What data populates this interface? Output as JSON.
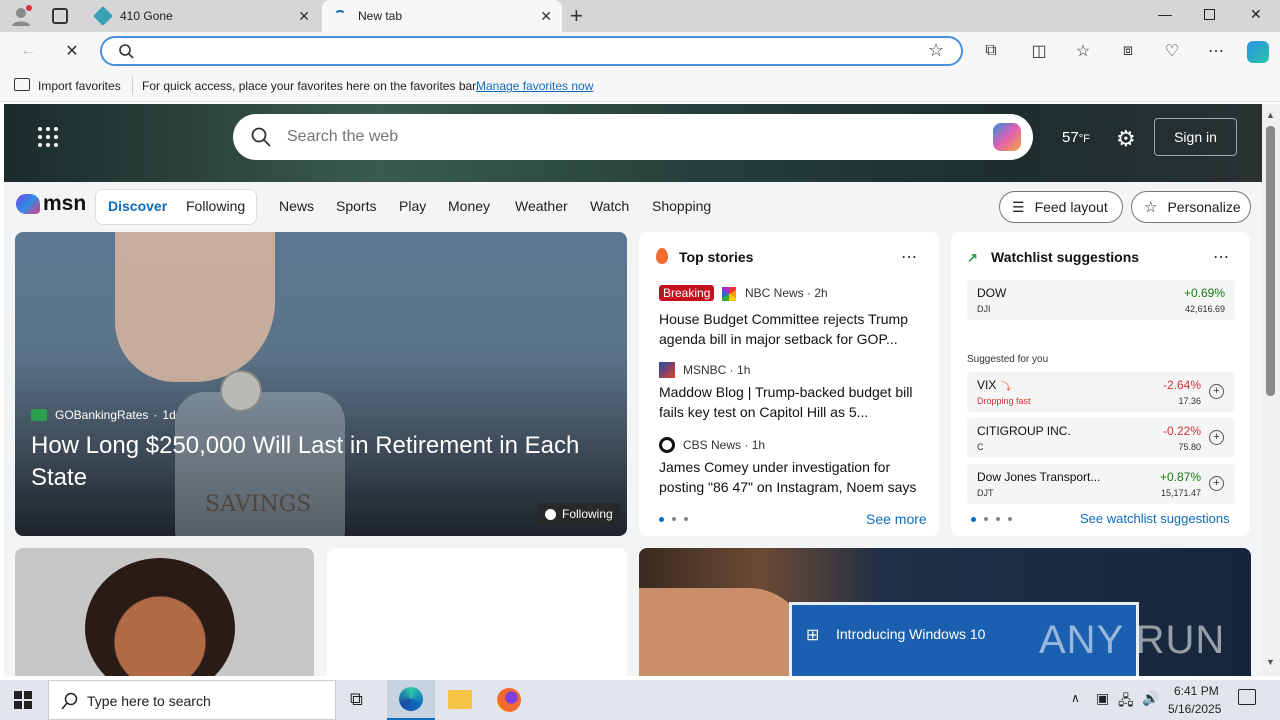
{
  "tabs": [
    {
      "title": "410 Gone"
    },
    {
      "title": "New tab"
    }
  ],
  "address": {
    "placeholder": ""
  },
  "favbar": {
    "import": "Import favorites",
    "message": "For quick access, place your favorites here on the favorites bar.",
    "link": "Manage favorites now"
  },
  "msn": {
    "search_placeholder": "Search the web",
    "temperature": "57",
    "temp_unit": "°F",
    "sign_in": "Sign in",
    "logo": "msn"
  },
  "nav": {
    "discover": "Discover",
    "following": "Following",
    "links": [
      "News",
      "Sports",
      "Play",
      "Money",
      "Weather",
      "Watch",
      "Shopping"
    ],
    "feed_layout": "Feed layout",
    "personalize": "Personalize"
  },
  "hero": {
    "source": "GOBankingRates",
    "age": "1d",
    "title": "How Long $250,000 Will Last in Retirement in Each State",
    "following_badge": "Following",
    "jar_text": "SAVINGS"
  },
  "top_stories": {
    "title": "Top stories",
    "items": [
      {
        "badge": "Breaking",
        "source": "NBC News",
        "age": "2h",
        "headline": "House Budget Committee rejects Trump agenda bill in major setback for GOP..."
      },
      {
        "source": "MSNBC",
        "age": "1h",
        "headline": "Maddow Blog | Trump-backed budget bill fails key test on Capitol Hill as 5..."
      },
      {
        "source": "CBS News",
        "age": "1h",
        "headline": "James Comey under investigation for posting \"86 47\" on Instagram, Noem says"
      }
    ],
    "see_more": "See more"
  },
  "watchlist": {
    "title": "Watchlist suggestions",
    "top": {
      "name": "DOW",
      "sym": "DJI",
      "change": "+0.69%",
      "price": "42,616.69"
    },
    "suggested_label": "Suggested for you",
    "items": [
      {
        "name": "VIX",
        "sym": "Dropping fast",
        "change": "-2.64%",
        "price": "17.36"
      },
      {
        "name": "CITIGROUP INC.",
        "sym": "C",
        "change": "-0.22%",
        "price": "75.80"
      },
      {
        "name": "Dow Jones Transport...",
        "sym": "DJT",
        "change": "+0.87%",
        "price": "15,171.47"
      }
    ],
    "see_all": "See watchlist suggestions"
  },
  "win_banner": {
    "text": "Introducing Windows 10",
    "watermark": "ANY RUN"
  },
  "taskbar": {
    "search_placeholder": "Type here to search",
    "time": "6:41 PM",
    "date": "5/16/2025"
  },
  "colors": {
    "accent": "#0f6cbd",
    "positive": "#107c10",
    "negative": "#d13438",
    "breaking": "#c50f1f"
  }
}
